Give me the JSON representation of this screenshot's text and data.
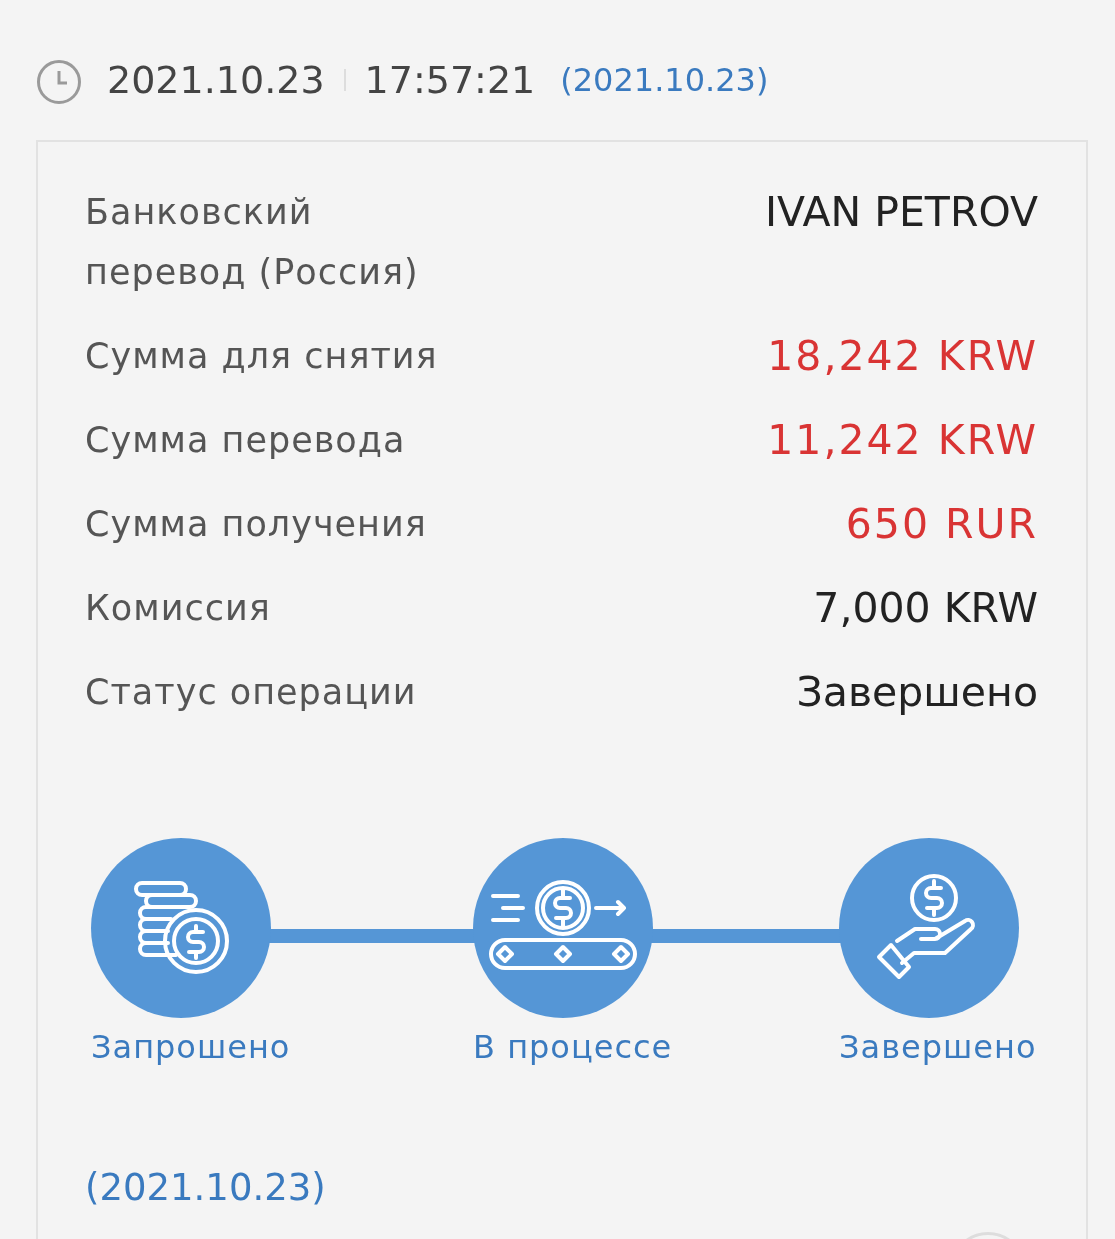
{
  "header": {
    "date": "2021.10.23",
    "time": "17:57:21",
    "date_note": "(2021.10.23)"
  },
  "details": [
    {
      "label": "Банковский перевод (Россия)",
      "value": "IVAN PETROV",
      "highlight": false
    },
    {
      "label": "Сумма для снятия",
      "value": "18,242 KRW",
      "highlight": true
    },
    {
      "label": "Сумма перевода",
      "value": "11,242 KRW",
      "highlight": true
    },
    {
      "label": "Сумма получения",
      "value": "650 RUR",
      "highlight": true
    },
    {
      "label": "Комиссия",
      "value": "7,000 KRW",
      "highlight": false
    },
    {
      "label": "Статус операции",
      "value": "Завершено",
      "highlight": false
    }
  ],
  "steps": [
    {
      "kind": "coins",
      "label": "Запрошено"
    },
    {
      "kind": "conveyor",
      "label": "В процессе"
    },
    {
      "kind": "hand",
      "label": "Завершено"
    }
  ],
  "footer_date": "(2021.10.23)"
}
